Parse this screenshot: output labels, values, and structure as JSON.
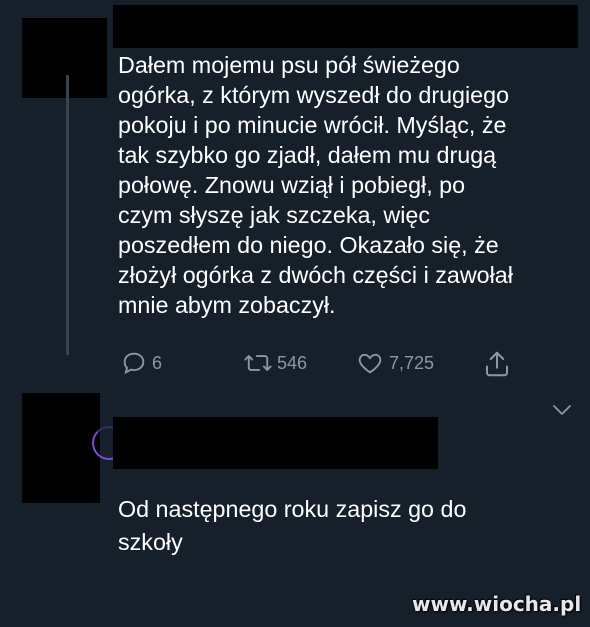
{
  "tweet": {
    "text_lines": [
      "Dałem mojemu psu pół świeżego",
      "ogórka, z którym wyszedł do drugiego",
      "pokoju i po minucie wrócił. Myśląc, że",
      "tak szybko go zjadł, dałem mu drugą",
      "połowę. Znowu wziął i pobiegł, po",
      "czym słyszę jak szczeka, więc",
      "poszedłem do niego. Okazało się, że",
      "złożył ogórka z dwóch części i zawołał",
      "mnie abym zobaczył."
    ],
    "actions": {
      "replies": "6",
      "retweets": "546",
      "likes": "7,725"
    }
  },
  "reply": {
    "text_lines": [
      "Od następnego roku zapisz go do",
      "szkoły"
    ]
  },
  "watermark": "www.wiocha.pl",
  "colors": {
    "background": "#15202b",
    "text": "#ffffff",
    "muted": "#8899a6",
    "redaction": "#000000",
    "avatar_ring": "#7b4bd6"
  },
  "icons": [
    "reply-icon",
    "retweet-icon",
    "like-icon",
    "share-icon",
    "chevron-down-icon"
  ]
}
